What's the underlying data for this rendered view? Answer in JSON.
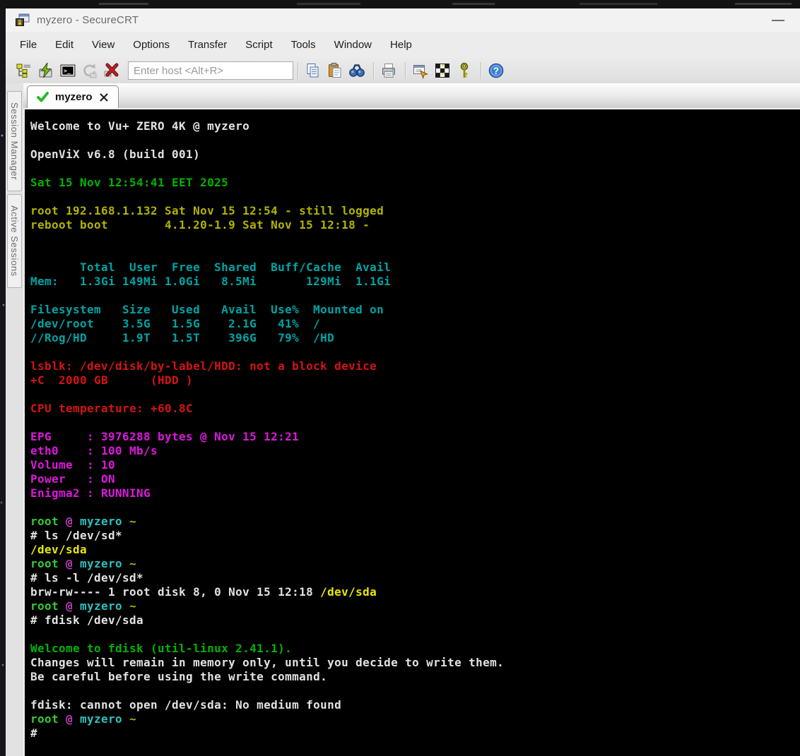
{
  "window": {
    "title": "myzero - SecureCRT",
    "minimize_tooltip": "Minimize"
  },
  "menu": {
    "items": [
      "File",
      "Edit",
      "View",
      "Options",
      "Transfer",
      "Script",
      "Tools",
      "Window",
      "Help"
    ]
  },
  "toolbar": {
    "host_placeholder": "Enter host <Alt+R>",
    "buttons": [
      "session-manager",
      "quick-connect",
      "console",
      "reconnect",
      "disconnect",
      "copy",
      "paste",
      "find",
      "print",
      "session-options",
      "run-script",
      "key-agent",
      "help"
    ]
  },
  "sidebar": {
    "tabs": [
      "Session Manager",
      "Active Sessions"
    ]
  },
  "session_tab": {
    "label": "myzero",
    "status_icon": "connected-check"
  },
  "terminal": {
    "colors": {
      "white": "#e2e2e2",
      "green": "#00b400",
      "lime": "#33cc33",
      "olive": "#b3b300",
      "yellow": "#e9e900",
      "cyan": "#00a4a4",
      "bcyan": "#2fc0c0",
      "red": "#d41414",
      "magenta": "#dd18dd",
      "purple": "#c040c0"
    },
    "lines": [
      [
        {
          "c": "white",
          "t": "Welcome to Vu+ ZERO 4K @ myzero"
        }
      ],
      [],
      [
        {
          "c": "white",
          "t": "OpenViX v6.8 (build 001)"
        }
      ],
      [],
      [
        {
          "c": "green",
          "t": "Sat 15 Nov 12:54:41 EET 2025"
        }
      ],
      [],
      [
        {
          "c": "olive",
          "t": "root 192.168.1.132 Sat Nov 15 12:54 - still logged"
        }
      ],
      [
        {
          "c": "olive",
          "t": "reboot boot        4.1.20-1.9 Sat Nov 15 12:18 -"
        }
      ],
      [],
      [],
      [
        {
          "c": "cyan",
          "t": "       Total  User  Free  Shared  Buff/Cache  Avail"
        }
      ],
      [
        {
          "c": "cyan",
          "t": "Mem:   1.3Gi 149Mi 1.0Gi   8.5Mi       129Mi  1.1Gi"
        }
      ],
      [],
      [
        {
          "c": "cyan",
          "t": "Filesystem   Size   Used   Avail  Use%  Mounted on"
        }
      ],
      [
        {
          "c": "cyan",
          "t": "/dev/root    3.5G   1.5G    2.1G   41%  /"
        }
      ],
      [
        {
          "c": "cyan",
          "t": "//Rog/HD     1.9T   1.5T    396G   79%  /HD"
        }
      ],
      [],
      [
        {
          "c": "red",
          "t": "lsblk: /dev/disk/by-label/HDD: not a block device"
        }
      ],
      [
        {
          "c": "red",
          "t": "+C  2000 GB      (HDD )"
        }
      ],
      [],
      [
        {
          "c": "red",
          "t": "CPU temperature: +60.8C"
        }
      ],
      [],
      [
        {
          "c": "magenta",
          "t": "EPG     : 3976288 bytes @ Nov 15 12:21"
        }
      ],
      [
        {
          "c": "magenta",
          "t": "eth0    : 100 Mb/s"
        }
      ],
      [
        {
          "c": "magenta",
          "t": "Volume  : 10"
        }
      ],
      [
        {
          "c": "magenta",
          "t": "Power   : ON"
        }
      ],
      [
        {
          "c": "magenta",
          "t": "Enigma2 : RUNNING"
        }
      ],
      [],
      [
        {
          "c": "lime",
          "t": "root "
        },
        {
          "c": "purple",
          "t": "@ "
        },
        {
          "c": "bcyan",
          "t": "myzero "
        },
        {
          "c": "olive",
          "t": "~"
        }
      ],
      [
        {
          "c": "white",
          "t": "# ls /dev/sd*"
        }
      ],
      [
        {
          "c": "yellow",
          "t": "/dev/sda"
        }
      ],
      [
        {
          "c": "lime",
          "t": "root "
        },
        {
          "c": "purple",
          "t": "@ "
        },
        {
          "c": "bcyan",
          "t": "myzero "
        },
        {
          "c": "olive",
          "t": "~"
        }
      ],
      [
        {
          "c": "white",
          "t": "# ls -l /dev/sd*"
        }
      ],
      [
        {
          "c": "white",
          "t": "brw-rw---- 1 root disk 8, 0 Nov 15 12:18 "
        },
        {
          "c": "yellow",
          "t": "/dev/sda"
        }
      ],
      [
        {
          "c": "lime",
          "t": "root "
        },
        {
          "c": "purple",
          "t": "@ "
        },
        {
          "c": "bcyan",
          "t": "myzero "
        },
        {
          "c": "olive",
          "t": "~"
        }
      ],
      [
        {
          "c": "white",
          "t": "# fdisk /dev/sda"
        }
      ],
      [],
      [
        {
          "c": "green",
          "t": "Welcome to fdisk (util-linux 2.41.1)."
        }
      ],
      [
        {
          "c": "white",
          "t": "Changes will remain in memory only, until you decide to write them."
        }
      ],
      [
        {
          "c": "white",
          "t": "Be careful before using the write command."
        }
      ],
      [],
      [
        {
          "c": "white",
          "t": "fdisk: cannot open /dev/sda: No medium found"
        }
      ],
      [
        {
          "c": "lime",
          "t": "root "
        },
        {
          "c": "purple",
          "t": "@ "
        },
        {
          "c": "bcyan",
          "t": "myzero "
        },
        {
          "c": "olive",
          "t": "~"
        }
      ],
      [
        {
          "c": "white",
          "t": "#"
        }
      ]
    ]
  }
}
